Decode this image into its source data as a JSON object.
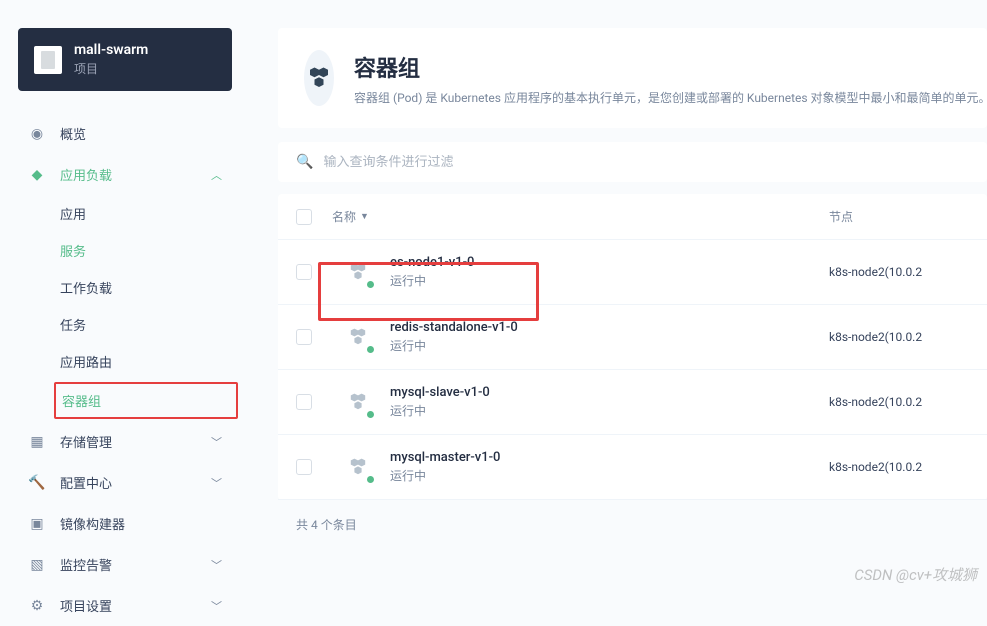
{
  "project": {
    "name": "mall-swarm",
    "label": "项目"
  },
  "sidebar": {
    "overview": "概览",
    "workload": "应用负载",
    "sub": [
      "应用",
      "服务",
      "工作负载",
      "任务",
      "应用路由",
      "容器组"
    ],
    "storage": "存储管理",
    "config": "配置中心",
    "image": "镜像构建器",
    "monitor": "监控告警",
    "settings": "项目设置"
  },
  "header": {
    "title": "容器组",
    "desc": "容器组 (Pod) 是 Kubernetes 应用程序的基本执行单元，是您创建或部署的 Kubernetes 对象模型中最小和最简单的单元。"
  },
  "search": {
    "placeholder": "输入查询条件进行过滤"
  },
  "table": {
    "colName": "名称",
    "colNode": "节点",
    "rows": [
      {
        "name": "es-node1-v1-0",
        "status": "运行中",
        "node": "k8s-node2(10.0.2"
      },
      {
        "name": "redis-standalone-v1-0",
        "status": "运行中",
        "node": "k8s-node2(10.0.2"
      },
      {
        "name": "mysql-slave-v1-0",
        "status": "运行中",
        "node": "k8s-node2(10.0.2"
      },
      {
        "name": "mysql-master-v1-0",
        "status": "运行中",
        "node": "k8s-node2(10.0.2"
      }
    ],
    "footer": "共 4 个条目"
  },
  "watermark": "CSDN @cv+攻城狮"
}
